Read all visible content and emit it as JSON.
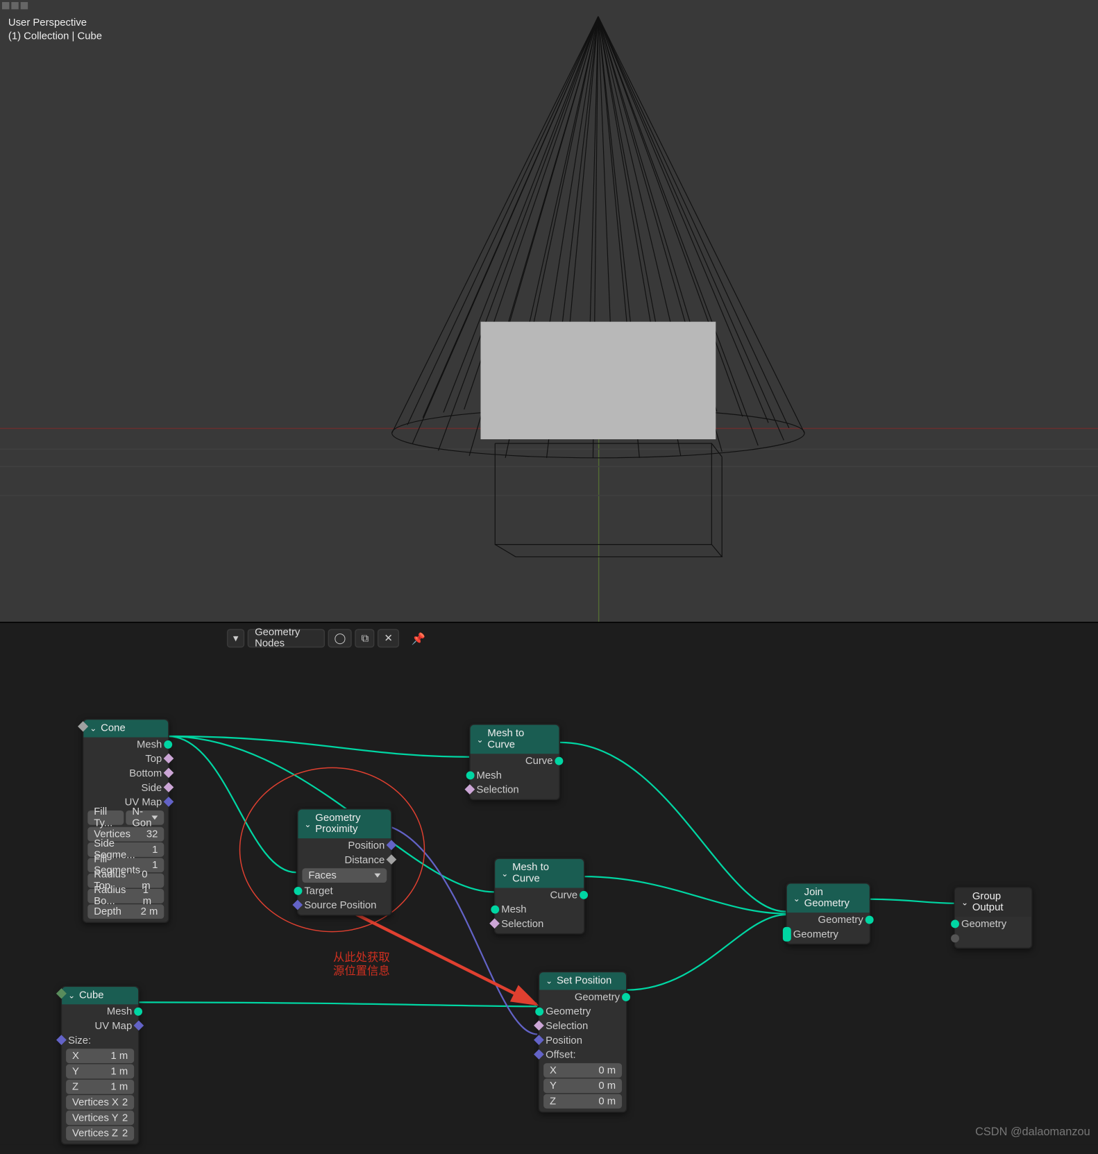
{
  "viewport": {
    "perspective": "User Perspective",
    "context": "(1) Collection | Cube"
  },
  "node_editor": {
    "tree_name": "Geometry Nodes",
    "pin_icon": "pin-icon",
    "shield_icon": "shield-icon",
    "copy_icon": "copy-icon",
    "close_icon": "close-icon"
  },
  "nodes": {
    "cone": {
      "title": "Cone",
      "outputs": {
        "mesh": "Mesh",
        "top": "Top",
        "bottom": "Bottom",
        "side": "Side",
        "uv": "UV Map"
      },
      "fill_type_label": "Fill Ty...",
      "fill_type_value": "N-Gon",
      "vertices": {
        "label": "Vertices",
        "value": "32"
      },
      "side_seg": {
        "label": "Side Segme...",
        "value": "1"
      },
      "fill_seg": {
        "label": "Fill Segments",
        "value": "1"
      },
      "radius_top": {
        "label": "Radius Top",
        "value": "0 m"
      },
      "radius_bot": {
        "label": "Radius Bo...",
        "value": "1 m"
      },
      "depth": {
        "label": "Depth",
        "value": "2 m"
      }
    },
    "cube": {
      "title": "Cube",
      "outputs": {
        "mesh": "Mesh",
        "uv": "UV Map"
      },
      "size_label": "Size:",
      "x": {
        "label": "X",
        "value": "1 m"
      },
      "y": {
        "label": "Y",
        "value": "1 m"
      },
      "z": {
        "label": "Z",
        "value": "1 m"
      },
      "vx": {
        "label": "Vertices X",
        "value": "2"
      },
      "vy": {
        "label": "Vertices Y",
        "value": "2"
      },
      "vz": {
        "label": "Vertices Z",
        "value": "2"
      }
    },
    "proximity": {
      "title": "Geometry Proximity",
      "outputs": {
        "position": "Position",
        "distance": "Distance"
      },
      "mode": "Faces",
      "inputs": {
        "target": "Target",
        "source": "Source Position"
      }
    },
    "mesh_to_curve_1": {
      "title": "Mesh to Curve",
      "out": "Curve",
      "in_mesh": "Mesh",
      "in_sel": "Selection"
    },
    "mesh_to_curve_2": {
      "title": "Mesh to Curve",
      "out": "Curve",
      "in_mesh": "Mesh",
      "in_sel": "Selection"
    },
    "set_position": {
      "title": "Set Position",
      "out": "Geometry",
      "in_geo": "Geometry",
      "in_sel": "Selection",
      "in_pos": "Position",
      "offset_label": "Offset:",
      "ox": {
        "label": "X",
        "value": "0 m"
      },
      "oy": {
        "label": "Y",
        "value": "0 m"
      },
      "oz": {
        "label": "Z",
        "value": "0 m"
      }
    },
    "join": {
      "title": "Join Geometry",
      "out": "Geometry",
      "in": "Geometry"
    },
    "output": {
      "title": "Group Output",
      "in": "Geometry"
    }
  },
  "annotation": {
    "line1": "从此处获取",
    "line2": "源位置信息"
  },
  "watermark": "CSDN @dalaomanzou"
}
